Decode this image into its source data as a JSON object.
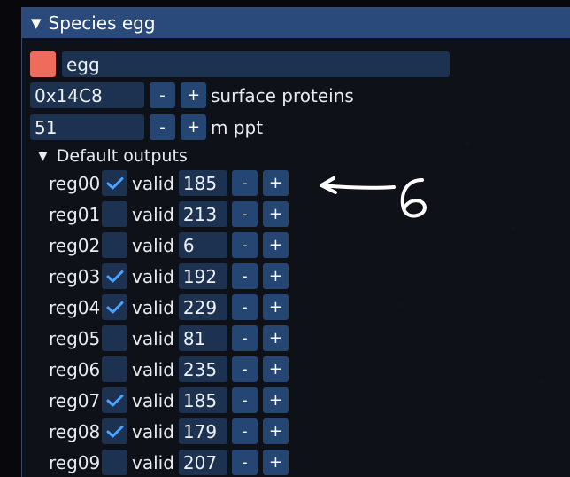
{
  "window": {
    "title": "Species egg"
  },
  "species": {
    "color": "#ef6b5c",
    "name": "egg",
    "surface_proteins": {
      "value": "0x14C8",
      "label": "surface proteins",
      "minus": "-",
      "plus": "+"
    },
    "m_ppt": {
      "value": "51",
      "label": "m ppt",
      "minus": "-",
      "plus": "+"
    }
  },
  "default_outputs": {
    "header": "Default outputs",
    "valid_label": "valid",
    "minus": "-",
    "plus": "+",
    "rows": [
      {
        "name": "reg00",
        "checked": true,
        "valid": "valid",
        "value": "185"
      },
      {
        "name": "reg01",
        "checked": false,
        "valid": "valid",
        "value": "213"
      },
      {
        "name": "reg02",
        "checked": false,
        "valid": "valid",
        "value": "6"
      },
      {
        "name": "reg03",
        "checked": true,
        "valid": "valid",
        "value": "192"
      },
      {
        "name": "reg04",
        "checked": true,
        "valid": "valid",
        "value": "229"
      },
      {
        "name": "reg05",
        "checked": false,
        "valid": "valid",
        "value": "81"
      },
      {
        "name": "reg06",
        "checked": false,
        "valid": "valid",
        "value": "235"
      },
      {
        "name": "reg07",
        "checked": true,
        "valid": "valid",
        "value": "185"
      },
      {
        "name": "reg08",
        "checked": true,
        "valid": "valid",
        "value": "179"
      },
      {
        "name": "reg09",
        "checked": false,
        "valid": "valid",
        "value": "207"
      }
    ]
  },
  "colors": {
    "accent": "#294a7a",
    "check": "#4aa3ff"
  }
}
